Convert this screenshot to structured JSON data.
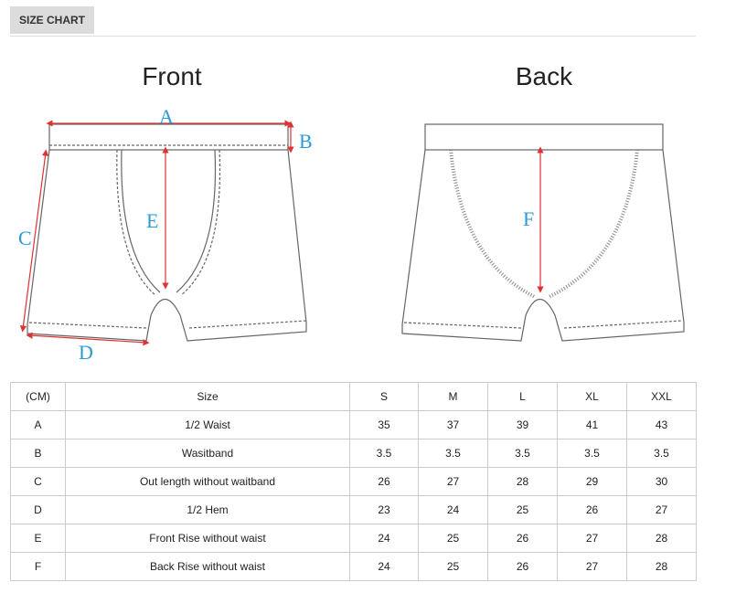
{
  "tab": {
    "label": "SIZE CHART"
  },
  "figure": {
    "front_title": "Front",
    "back_title": "Back",
    "labels": {
      "A": "A",
      "B": "B",
      "C": "C",
      "D": "D",
      "E": "E",
      "F": "F"
    },
    "colors": {
      "arrow": "#d33",
      "label": "#2a9bd6",
      "outline": "#666"
    }
  },
  "table": {
    "headers": [
      "(CM)",
      "Size",
      "S",
      "M",
      "L",
      "XL",
      "XXL"
    ],
    "rows": [
      [
        "A",
        "1/2 Waist",
        "35",
        "37",
        "39",
        "41",
        "43"
      ],
      [
        "B",
        "Wasitband",
        "3.5",
        "3.5",
        "3.5",
        "3.5",
        "3.5"
      ],
      [
        "C",
        "Out length without waitband",
        "26",
        "27",
        "28",
        "29",
        "30"
      ],
      [
        "D",
        "1/2  Hem",
        "23",
        "24",
        "25",
        "26",
        "27"
      ],
      [
        "E",
        "Front Rise without waist",
        "24",
        "25",
        "26",
        "27",
        "28"
      ],
      [
        "F",
        "Back Rise without waist",
        "24",
        "25",
        "26",
        "27",
        "28"
      ]
    ]
  }
}
